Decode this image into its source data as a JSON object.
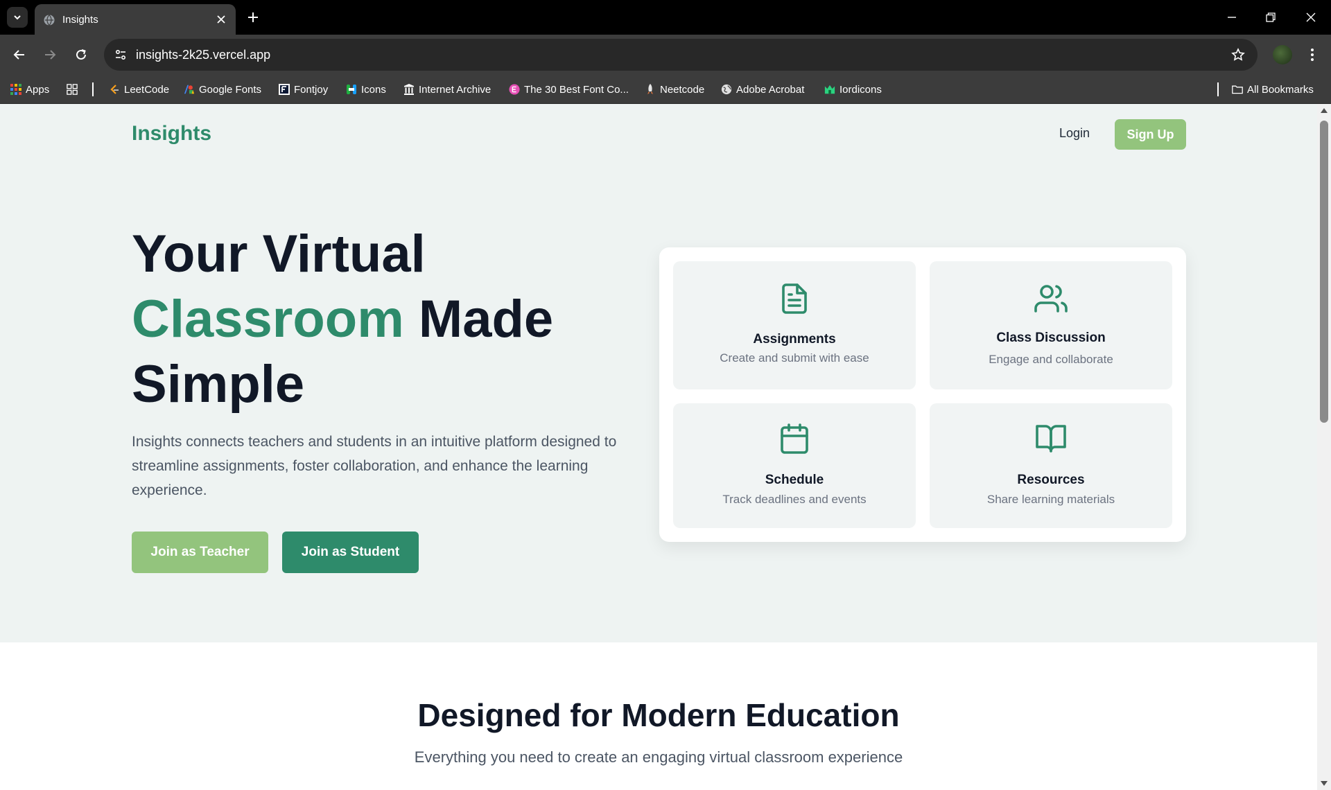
{
  "browser": {
    "tab_title": "Insights",
    "url": "insights-2k25.vercel.app",
    "bookmarks": [
      {
        "label": "Apps",
        "icon": "apps-grid-icon"
      },
      {
        "label": "LeetCode",
        "icon": "leetcode-icon"
      },
      {
        "label": "Google Fonts",
        "icon": "google-fonts-icon"
      },
      {
        "label": "Fontjoy",
        "icon": "fontjoy-icon"
      },
      {
        "label": "Icons",
        "icon": "icons8-icon"
      },
      {
        "label": "Internet Archive",
        "icon": "internet-archive-icon"
      },
      {
        "label": "The 30 Best Font Co...",
        "icon": "font-collection-icon"
      },
      {
        "label": "Neetcode",
        "icon": "neetcode-icon"
      },
      {
        "label": "Adobe Acrobat",
        "icon": "globe-icon"
      },
      {
        "label": "Iordicons",
        "icon": "lordicons-icon"
      }
    ],
    "all_bookmarks": "All Bookmarks"
  },
  "nav": {
    "brand": "Insights",
    "login": "Login",
    "signup": "Sign Up"
  },
  "hero": {
    "title_line1": "Your Virtual",
    "title_accent": "Classroom",
    "title_rest": " Made",
    "title_line3": "Simple",
    "description": "Insights connects teachers and students in an intuitive platform designed to streamline assignments, foster collaboration, and enhance the learning experience.",
    "btn_teacher": "Join as Teacher",
    "btn_student": "Join as Student"
  },
  "features": [
    {
      "title": "Assignments",
      "desc": "Create and submit with ease",
      "icon": "file-text-icon"
    },
    {
      "title": "Class Discussion",
      "desc": "Engage and collaborate",
      "icon": "users-icon"
    },
    {
      "title": "Schedule",
      "desc": "Track deadlines and events",
      "icon": "calendar-icon"
    },
    {
      "title": "Resources",
      "desc": "Share learning materials",
      "icon": "book-open-icon"
    }
  ],
  "section": {
    "title": "Designed for Modern Education",
    "subtitle": "Everything you need to create an engaging virtual classroom experience"
  },
  "colors": {
    "accent": "#2e8b6b",
    "accent_light": "#93c47d",
    "hero_bg": "#eef3f2",
    "card_bg": "#f1f4f4",
    "heading": "#111827"
  }
}
